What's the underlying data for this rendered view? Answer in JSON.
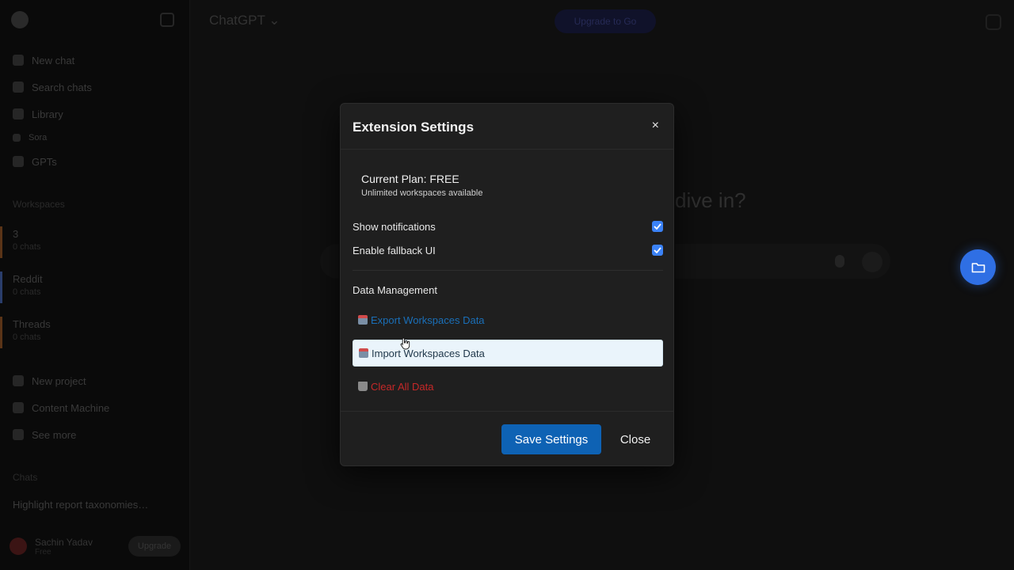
{
  "background": {
    "model_name": "ChatGPT",
    "plus_label": "Upgrade to Go",
    "heading_fragment": "dive in?",
    "sidebar": {
      "items": [
        {
          "label": "New chat",
          "icon": "edit-icon"
        },
        {
          "label": "Search chats",
          "icon": "search-icon"
        },
        {
          "label": "Library",
          "icon": "library-icon"
        },
        {
          "label": "Sora",
          "icon": "sora-icon"
        },
        {
          "label": "GPTs",
          "icon": "grid-icon"
        }
      ],
      "workspaces_heading": "Workspaces",
      "workspaces": [
        {
          "title": "3",
          "subtitle": "0 chats",
          "color": "#5a3417"
        },
        {
          "title": "Reddit",
          "subtitle": "0 chats",
          "color": "#2a3d6b"
        },
        {
          "title": "Threads",
          "subtitle": "0 chats",
          "color": "#5a3417"
        }
      ],
      "bottom_items": [
        {
          "label": "New project",
          "icon": "folder-plus-icon"
        },
        {
          "label": "Content Machine",
          "icon": "folder-icon"
        },
        {
          "label": "See more",
          "icon": "more-icon"
        }
      ],
      "chats_heading": "Chats",
      "chat_preview": "Highlight report taxonomies…",
      "user_name": "Sachin Yadav",
      "user_plan": "Free",
      "upgrade_label": "Upgrade"
    }
  },
  "modal": {
    "title": "Extension Settings",
    "close_glyph": "×",
    "plan_title": "Current Plan: FREE",
    "plan_subtitle": "Unlimited workspaces available",
    "options": [
      {
        "label": "Show notifications",
        "checked": true
      },
      {
        "label": "Enable fallback UI",
        "checked": true
      }
    ],
    "data_management_title": "Data Management",
    "actions": {
      "export_label": "Export Workspaces Data",
      "import_label": "Import Workspaces Data",
      "clear_label": "Clear All Data"
    },
    "save_label": "Save Settings",
    "close_label": "Close"
  },
  "colors": {
    "accent": "#0e62b4",
    "checkbox": "#3b82f6",
    "danger": "#c62828",
    "link": "#1a6fb8",
    "fab": "#2f6fe4"
  }
}
